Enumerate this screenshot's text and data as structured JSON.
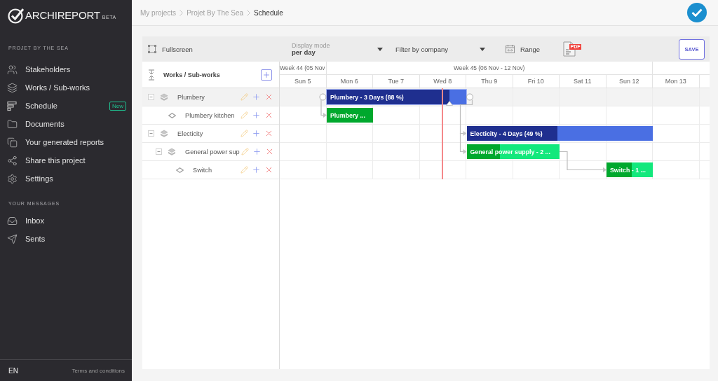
{
  "sidebar": {
    "logo": {
      "name": "ARCHIREPORT",
      "tag": "BETA"
    },
    "project_heading": "PROJET BY THE SEA",
    "project_items": [
      {
        "label": "Stakeholders"
      },
      {
        "label": "Works / Sub-works"
      },
      {
        "label": "Schedule",
        "badge": "New"
      },
      {
        "label": "Documents"
      },
      {
        "label": "Your generated reports"
      },
      {
        "label": "Share this project"
      },
      {
        "label": "Settings"
      }
    ],
    "messages_heading": "YOUR MESSAGES",
    "message_items": [
      {
        "label": "Inbox"
      },
      {
        "label": "Sents"
      }
    ],
    "footer": {
      "language": "EN",
      "terms_link": "Terms and conditions"
    }
  },
  "breadcrumb": [
    {
      "label": "My projects",
      "current": false
    },
    {
      "label": "Projet By The Sea",
      "current": false
    },
    {
      "label": "Schedule",
      "current": true
    }
  ],
  "toolbar": {
    "fullscreen": "Fullscreen",
    "display_mode": {
      "label": "Display mode",
      "value": "per day"
    },
    "company_filter": {
      "placeholder": "Filter by company"
    },
    "range": "Range",
    "pdf_tag": "PDF",
    "save": "SAVE"
  },
  "tree": {
    "heading": "Works / Sub-works",
    "items": [
      {
        "name": "Plumbery",
        "kind": "group",
        "expanded": true,
        "selected": true,
        "bar": {
          "label": "Plumbery - 3 Days (88 %)",
          "level": 0.88
        },
        "children": [
          {
            "name": "Plumbery kitchen",
            "kind": "task",
            "selected": false,
            "bar": {
              "label": "Plumbery ...",
              "level": 1
            }
          }
        ]
      },
      {
        "name": "Electicity",
        "kind": "group",
        "expanded": true,
        "selected": false,
        "bar": {
          "label": "Electicity - 4 Days (49 %)",
          "level": 0.49
        },
        "children": [
          {
            "name": "General power sup",
            "kind": "group",
            "expanded": true,
            "selected": false,
            "bar": {
              "label": "General power supply - 2 ...",
              "level": 0.36
            },
            "children": [
              {
                "name": "Switch",
                "kind": "task",
                "selected": false,
                "bar": {
                  "label": "Switch - 1 ...",
                  "level": 0.55
                }
              }
            ]
          }
        ]
      }
    ]
  },
  "timeline": {
    "weeks": [
      {
        "label": "Week 44 (05 Nov"
      },
      {
        "label": "Week 45 (06 Nov - 12 Nov)"
      }
    ],
    "days": [
      "Sun 5",
      "Mon 6",
      "Tue 7",
      "Wed 8",
      "Thu 9",
      "Fri 10",
      "Sat 11",
      "Sun 12",
      "Mon 13"
    ]
  }
}
